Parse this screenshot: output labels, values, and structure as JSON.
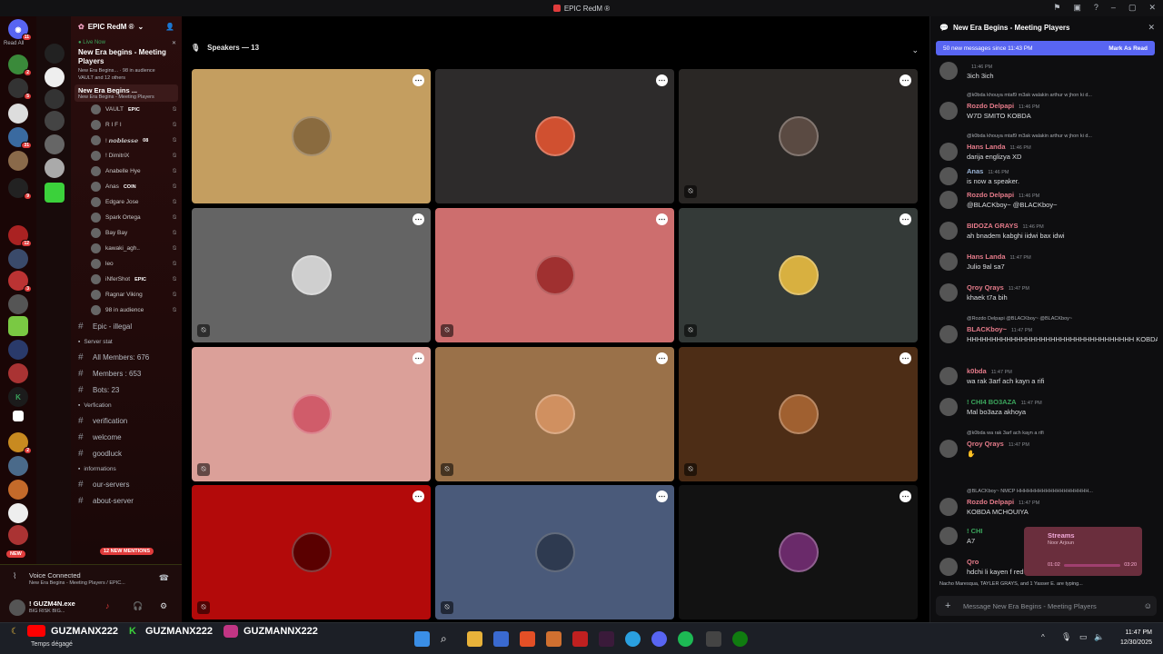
{
  "titlebar": {
    "title": "EPIC RedM ®"
  },
  "server_sidebar": {
    "read_all": "Read All",
    "new_label": "NEW"
  },
  "channels": {
    "server_name": "EPIC RedM ®",
    "live_now": "Live Now",
    "stage_title": "New Era begins - Meeting Players",
    "stage_sub": "New Era Begins... · 98 in audience",
    "stage_sub2": "VAULT and 12 others",
    "vc_name": "New Era Begins ...",
    "vc_sub": "New Era Begins - Meeting Players",
    "members": [
      {
        "name": "VAULT",
        "tag": "EPIC"
      },
      {
        "name": "R I F I",
        "tag": ""
      },
      {
        "name": "! 𝙣𝙤𝙗𝙡𝙚𝙨𝙨𝙚",
        "tag": "08"
      },
      {
        "name": "! DimitriX",
        "tag": ""
      },
      {
        "name": "Anabelle Hye",
        "tag": ""
      },
      {
        "name": "Anas",
        "tag": "COIN"
      },
      {
        "name": "Edgare Jose",
        "tag": ""
      },
      {
        "name": "Spark Ortega",
        "tag": ""
      },
      {
        "name": "Bay Bay",
        "tag": ""
      },
      {
        "name": "kawaki_agh..",
        "tag": ""
      },
      {
        "name": "leo",
        "tag": ""
      },
      {
        "name": "iNferShot",
        "tag": "EPIC"
      },
      {
        "name": "Ragnar Viking",
        "tag": ""
      },
      {
        "name": "98 in audience",
        "tag": ""
      }
    ],
    "list": [
      {
        "kind": "chan",
        "label": "Epic - illegal"
      },
      {
        "kind": "cat",
        "label": "Server stat"
      },
      {
        "kind": "chan",
        "label": "All Members: 676"
      },
      {
        "kind": "chan",
        "label": "Members : 653"
      },
      {
        "kind": "chan",
        "label": "Bots: 23"
      },
      {
        "kind": "cat",
        "label": "Verfication"
      },
      {
        "kind": "chan",
        "label": "verification"
      },
      {
        "kind": "chan",
        "label": "welcome"
      },
      {
        "kind": "chan",
        "label": "goodluck"
      },
      {
        "kind": "cat",
        "label": "informations"
      },
      {
        "kind": "chan",
        "label": "our-servers"
      },
      {
        "kind": "chan",
        "label": "about-server"
      }
    ],
    "mentions": "12 NEW MENTIONS"
  },
  "voice": {
    "status": "Voice Connected",
    "detail": "New Era Begins - Meeting Players / EPIC...",
    "user": "! GUZM4N.exe",
    "user_sub": "BIG RISK BIG..."
  },
  "stage": {
    "speakers_label": "Speakers — 13"
  },
  "tiles": [
    {
      "bg": "#c49e60",
      "av": "#8a6b3f",
      "mute": false
    },
    {
      "bg": "#2d2b2b",
      "av": "#d05030",
      "mute": false
    },
    {
      "bg": "#2a2725",
      "av": "#5a4a42",
      "mute": true
    },
    {
      "bg": "#646464",
      "av": "#cfcfcf",
      "mute": true
    },
    {
      "bg": "#cd6e6e",
      "av": "#a03030",
      "mute": true
    },
    {
      "bg": "#343a38",
      "av": "#d8b040",
      "mute": true
    },
    {
      "bg": "#dba099",
      "av": "#d05c6a",
      "mute": true
    },
    {
      "bg": "#9a7149",
      "av": "#d09060",
      "mute": true
    },
    {
      "bg": "#4d2d16",
      "av": "#a06030",
      "mute": true
    },
    {
      "bg": "#b30a0a",
      "av": "#5a0000",
      "mute": true
    },
    {
      "bg": "#4a5a7a",
      "av": "#2e3a50",
      "mute": true
    },
    {
      "bg": "#121212",
      "av": "#6a2a6a",
      "mute": false
    }
  ],
  "chat": {
    "title": "New Era Begins - Meeting Players",
    "new_messages": "50 new messages since 11:43 PM",
    "mark_read": "Mark As Read",
    "messages": [
      {
        "name": "",
        "color": "#dbdee1",
        "time": "11:46 PM",
        "reply": "",
        "text": "3ich 3ich"
      },
      {
        "name": "Rozdo Delpapi",
        "color": "#e57b8a",
        "time": "11:46 PM",
        "reply": "@k0bda khouya mtaf9 m3ak walakin arthur w jhon ki d...",
        "text": "W7D SMITO KOBDA"
      },
      {
        "name": "Hans Landa",
        "color": "#e57b8a",
        "time": "11:46 PM",
        "reply": "@k0bda khouya mtaf9 m3ak walakin arthur w jhon ki d...",
        "text": "darija englizya XD"
      },
      {
        "name": "Anas",
        "color": "#9ab4d6",
        "time": "11:46 PM",
        "reply": "",
        "text": "is now a speaker."
      },
      {
        "name": "Rozdo Delpapi",
        "color": "#e57b8a",
        "time": "11:46 PM",
        "reply": "",
        "text": "@BLACKboy~ @BLACKboy~"
      },
      {
        "name": "BIDOZA GRAYS",
        "color": "#e57b8a",
        "time": "11:46 PM",
        "reply": "",
        "text": "ah bnadem kabghi iidwi bax idwi"
      },
      {
        "name": "Hans Landa",
        "color": "#e57b8a",
        "time": "11:47 PM",
        "reply": "",
        "text": "Julio 9al sa7"
      },
      {
        "name": "Qroy Qrays",
        "color": "#e57b8a",
        "time": "11:47 PM",
        "reply": "",
        "text": "khaek t7a bih"
      },
      {
        "name": "BLACKboy~",
        "color": "#e57b8a",
        "time": "11:47 PM",
        "reply": "@Rozdo Delpapi @BLACKboy~ @BLACKboy~",
        "text": "HHHHHHHHHHHHHHHHHHHHHHHHHHHHHHHHHH KOBDA SANDWICH"
      },
      {
        "name": "k0bda",
        "color": "#e57b8a",
        "time": "11:47 PM",
        "reply": "",
        "text": "wa rak 3arf ach kayn a rifi"
      },
      {
        "name": "! CHI4 BO3AZA",
        "color": "#3ba55c",
        "time": "11:47 PM",
        "reply": "",
        "text": "Mal bo3aza akhoya"
      },
      {
        "name": "Qroy Qrays",
        "color": "#e57b8a",
        "time": "11:47 PM",
        "reply": "@k0bda wa rak 3arf ach kayn a rifi",
        "text": "✋"
      },
      {
        "name": "Rozdo Delpapi",
        "color": "#e57b8a",
        "time": "11:47 PM",
        "reply": "@BLACKboy~ NMCP HHHHHHHHHHHHHHHHHHHH...",
        "text": "KOBDA MCHOUIYA"
      },
      {
        "name": "! CHI",
        "color": "#3ba55c",
        "time": "",
        "reply": "",
        "text": "A7"
      },
      {
        "name": "Qro",
        "color": "#e57b8a",
        "time": "",
        "reply": "",
        "text": "hdchi li kayen f red zone"
      }
    ],
    "typing": "Nacho Maresqua, TAYLER GRAYS, and 1 Yasser E. are typing...",
    "stream_title": "Streams",
    "stream_sub": "Noor Arjoun",
    "stream_time_a": "01:02",
    "stream_time_b": "03:20",
    "input_placeholder": "Message New Era Begins - Meeting Players"
  },
  "overlay": {
    "handle1": "GUZMANX222",
    "handle2": "GUZMANX222",
    "handle3": "GUZMANNX222",
    "weather": "Temps dégagé"
  },
  "taskbar": {
    "time": "11:47 PM",
    "date": "12/30/2025"
  }
}
